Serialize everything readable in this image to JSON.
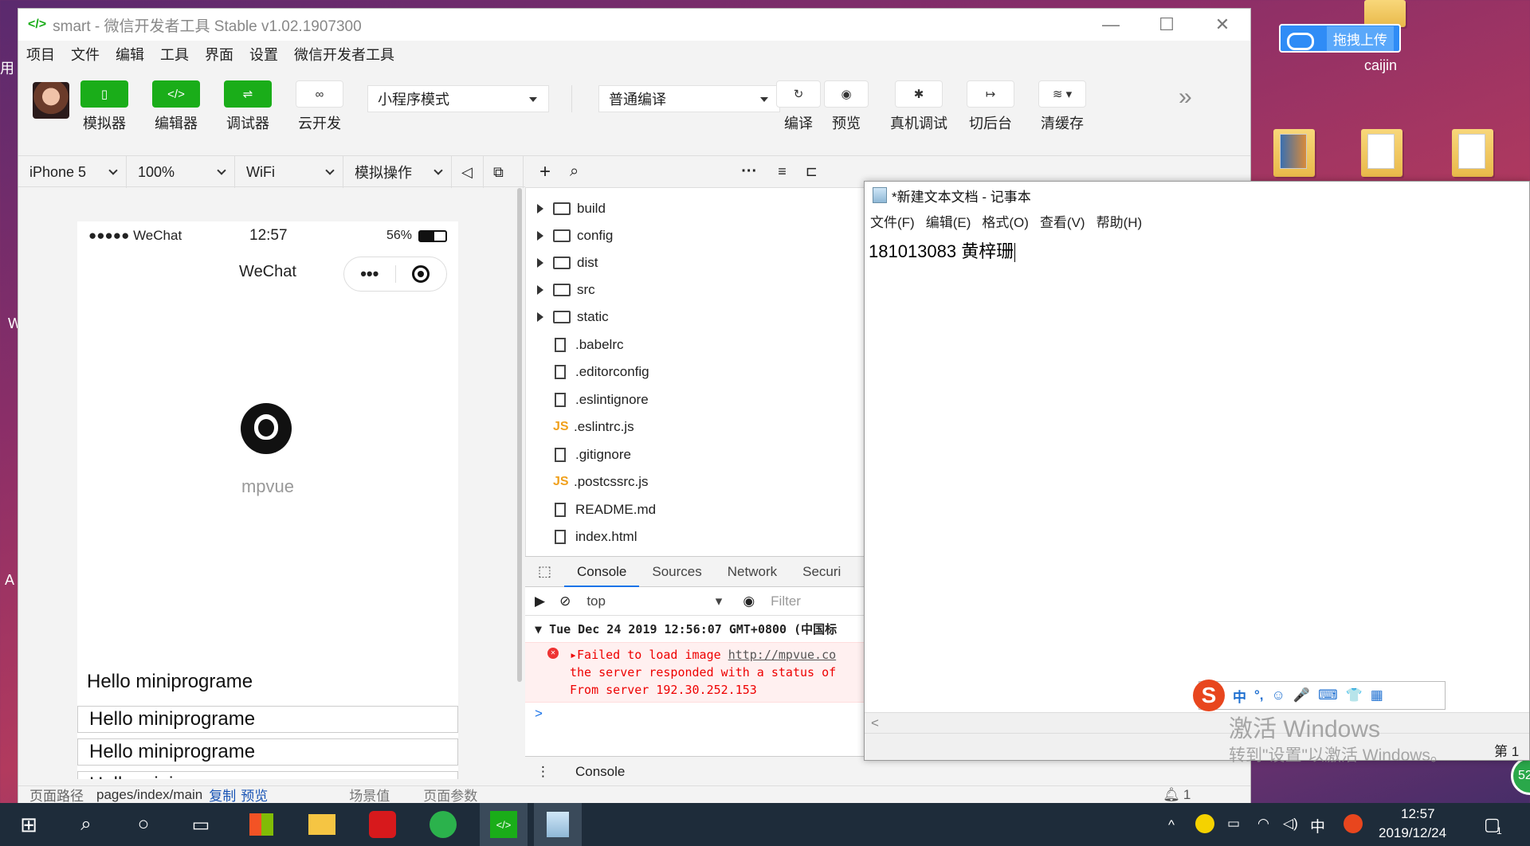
{
  "desktop": {
    "user_label": "caijin",
    "baidu_upload_label": "拖拽上传",
    "edge_chars": [
      "用",
      "W",
      "A"
    ],
    "watermark_line1": "激活 Windows",
    "watermark_line2": "转到\"设置\"以激活 Windows。",
    "badge_52": "52"
  },
  "window": {
    "title": "smart - 微信开发者工具 Stable v1.02.1907300",
    "menu": [
      "项目",
      "文件",
      "编辑",
      "工具",
      "界面",
      "设置",
      "微信开发者工具"
    ]
  },
  "toolbar": {
    "simulator": "模拟器",
    "editor": "编辑器",
    "debugger": "调试器",
    "cloud": "云开发",
    "mode_select": "小程序模式",
    "compile_select": "普通编译",
    "compile": "编译",
    "preview": "预览",
    "remote_debug": "真机调试",
    "background": "切后台",
    "clear_cache": "清缓存",
    "more": "»"
  },
  "subbar": {
    "device": "iPhone 5",
    "zoom": "100%",
    "network": "WiFi",
    "sim_ops": "模拟操作"
  },
  "phone": {
    "signal": "●●●●● WeChat",
    "time": "12:57",
    "battery": "56%",
    "nav_title": "WeChat",
    "app_name": "mpvue",
    "hello_plain": "Hello miniprograme",
    "hello_boxes": [
      "Hello miniprograme",
      "Hello miniprograme",
      "Hello miniprograme"
    ]
  },
  "footer": {
    "path_label": "页面路径",
    "path_value": "pages/index/main",
    "copy": "复制",
    "preview": "预览",
    "scene": "场景值",
    "params": "页面参数",
    "notif_count": "1"
  },
  "tree": {
    "folders": [
      "build",
      "config",
      "dist",
      "src",
      "static"
    ],
    "files": [
      {
        "name": ".babelrc",
        "type": "file"
      },
      {
        "name": ".editorconfig",
        "type": "file"
      },
      {
        "name": ".eslintignore",
        "type": "file"
      },
      {
        "name": ".eslintrc.js",
        "type": "js"
      },
      {
        "name": ".gitignore",
        "type": "file"
      },
      {
        "name": ".postcssrc.js",
        "type": "js"
      },
      {
        "name": "README.md",
        "type": "file"
      },
      {
        "name": "index.html",
        "type": "file"
      }
    ]
  },
  "console": {
    "tabs": [
      "Console",
      "Sources",
      "Network",
      "Securi"
    ],
    "context": "top",
    "filter_placeholder": "Filter",
    "group_header": "Tue Dec 24 2019 12:56:07 GMT+0800 (中国标",
    "error_line1_prefix": "Failed to load image ",
    "error_line1_link": "http://mpvue.co",
    "error_line2": "the server responded with a status of",
    "error_line3": "From server 192.30.252.153",
    "prompt": ">",
    "drawer_tab": "Console"
  },
  "notepad": {
    "title": "*新建文本文档 - 记事本",
    "menu": [
      "文件(F)",
      "编辑(E)",
      "格式(O)",
      "查看(V)",
      "帮助(H)"
    ],
    "content": "181013083 黄梓珊",
    "status_right": "第 1"
  },
  "ime": {
    "items": [
      "中",
      "°,",
      "☺",
      "🎤",
      "⌨",
      "👕",
      "▦"
    ]
  },
  "taskbar": {
    "clock_time": "12:57",
    "clock_date": "2019/12/24",
    "tray_lang": "中",
    "notif_badge": "1"
  }
}
